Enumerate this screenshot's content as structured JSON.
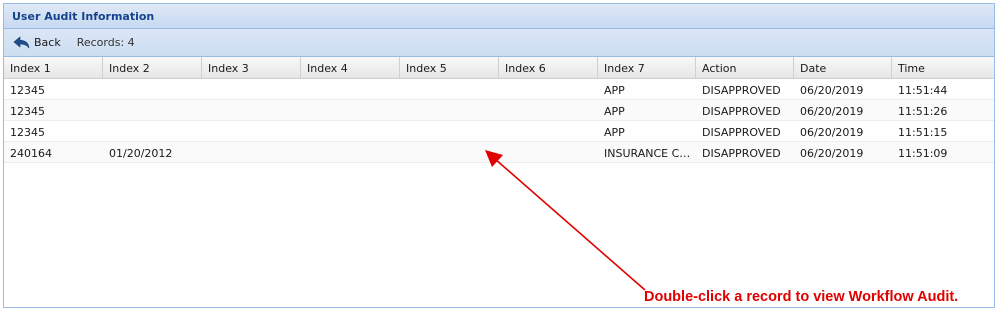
{
  "panel": {
    "title": "User Audit Information"
  },
  "toolbar": {
    "back_label": "Back",
    "records_label": "Records: 4",
    "back_icon": "back-arrow-icon"
  },
  "grid": {
    "columns": [
      "Index 1",
      "Index 2",
      "Index 3",
      "Index 4",
      "Index 5",
      "Index 6",
      "Index 7",
      "Action",
      "Date",
      "Time"
    ],
    "rows": [
      [
        "12345",
        "",
        "",
        "",
        "",
        "",
        "APP",
        "DISAPPROVED",
        "06/20/2019",
        "11:51:44"
      ],
      [
        "12345",
        "",
        "",
        "",
        "",
        "",
        "APP",
        "DISAPPROVED",
        "06/20/2019",
        "11:51:26"
      ],
      [
        "12345",
        "",
        "",
        "",
        "",
        "",
        "APP",
        "DISAPPROVED",
        "06/20/2019",
        "11:51:15"
      ],
      [
        "240164",
        "01/20/2012",
        "",
        "",
        "",
        "",
        "INSURANCE CA...",
        "DISAPPROVED",
        "06/20/2019",
        "11:51:09"
      ]
    ]
  },
  "annotation": {
    "text": "Double-click a record to view Workflow Audit.",
    "color": "#e00000"
  },
  "colors": {
    "header_text": "#15428b",
    "border": "#99bbe8"
  }
}
